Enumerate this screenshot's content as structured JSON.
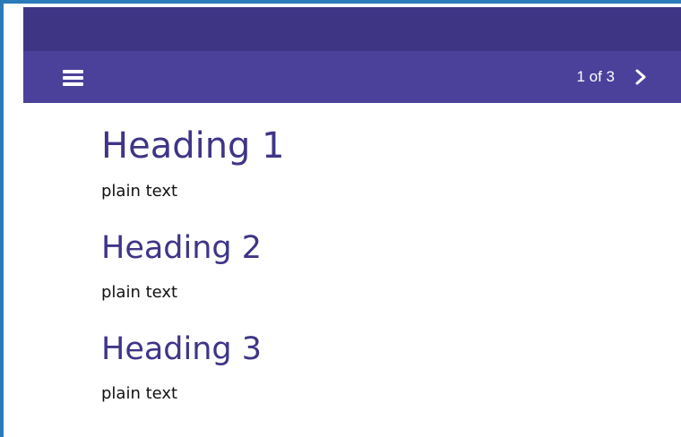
{
  "header": {
    "menu_icon": "hamburger-menu-icon",
    "pagination": {
      "label": "1 of 3",
      "next_icon": "chevron-right-icon"
    }
  },
  "colors": {
    "frame_border": "#2b7bb9",
    "top_bar": "#3e3585",
    "nav_bar": "#4b419a",
    "heading": "#3e3588"
  },
  "content": {
    "sections": [
      {
        "heading": "Heading 1",
        "text": "plain text"
      },
      {
        "heading": "Heading 2",
        "text": "plain text"
      },
      {
        "heading": "Heading 3",
        "text": "plain text"
      }
    ]
  }
}
